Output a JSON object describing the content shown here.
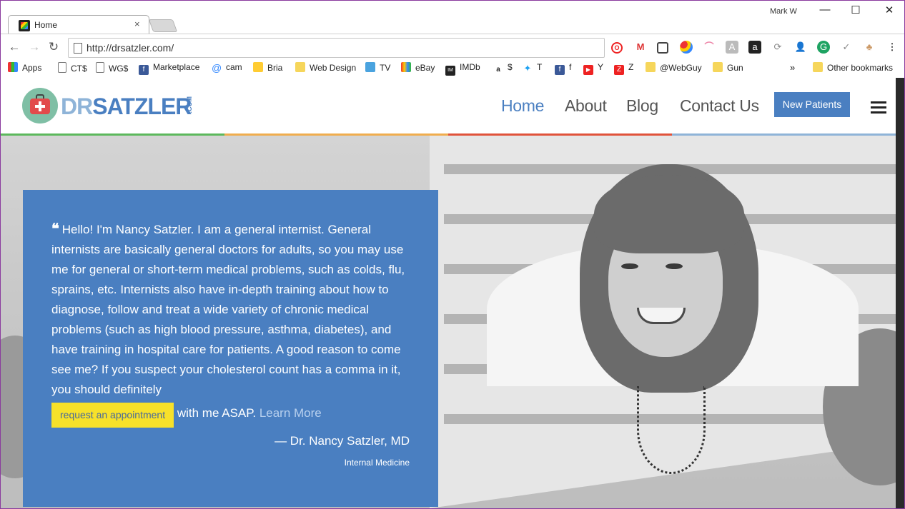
{
  "browser": {
    "tab_title": "Home",
    "tab_close": "×",
    "user_name": "Mark W",
    "url": "http://drsatzler.com/",
    "window_controls": {
      "minimize": "—",
      "maximize": "☐",
      "close": "✕"
    },
    "nav": {
      "back": "←",
      "forward": "→",
      "reload": "↻"
    },
    "menu_icon": "⋮",
    "bookmarks": [
      {
        "label": "Apps",
        "icon": "apps-grid-icon"
      },
      {
        "label": "CT$",
        "icon": "page-icon"
      },
      {
        "label": "WG$",
        "icon": "page-icon"
      },
      {
        "label": "Marketplace",
        "icon": "facebook-icon"
      },
      {
        "label": "cam",
        "icon": "at-icon"
      },
      {
        "label": "Bria",
        "icon": "bria-icon"
      },
      {
        "label": "Web Design",
        "icon": "folder-icon"
      },
      {
        "label": "TV",
        "icon": "tv-icon"
      },
      {
        "label": "eBay",
        "icon": "ebay-icon"
      },
      {
        "label": "IMDb",
        "icon": "imdb-icon"
      },
      {
        "label": "$",
        "icon": "amazon-icon"
      },
      {
        "label": "T",
        "icon": "twitter-icon"
      },
      {
        "label": "f",
        "icon": "facebook-icon"
      },
      {
        "label": "Y",
        "icon": "youtube-icon"
      },
      {
        "label": "Z",
        "icon": "z-icon"
      },
      {
        "label": "@WebGuy",
        "icon": "folder-icon"
      },
      {
        "label": "Gun",
        "icon": "folder-icon"
      }
    ],
    "bookmarks_overflow": "»",
    "other_bookmarks": "Other bookmarks"
  },
  "site": {
    "logo": {
      "dr": "DR",
      "name": "SATZLER",
      "com": ".COM"
    },
    "nav": [
      {
        "label": "Home",
        "active": true
      },
      {
        "label": "About",
        "active": false
      },
      {
        "label": "Blog",
        "active": false
      },
      {
        "label": "Contact Us",
        "active": false
      }
    ],
    "cta_button": "New Patients",
    "accent_colors": {
      "blue": "#4a7fc1",
      "yellow": "#f7e12a",
      "green": "#5cb85c",
      "orange": "#f0ad4e",
      "red": "#e0533b"
    },
    "hero": {
      "quote_mark": "❝",
      "quote_text": "Hello! I'm Nancy Satzler. I am a general internist. General internists are basically general doctors for adults, so you may use me for general or short-term medical problems, such as colds, flu, sprains, etc. Internists also have in-depth training about how to diagnose, follow and treat a wide variety of chronic medical problems (such as high blood pressure, asthma, diabetes), and have training in hospital care for patients. A good reason to come see me? If you suspect your cholesterol count has a comma in it, you should definitely",
      "appointment_button": "request an appointment",
      "after_button": " with me ASAP. ",
      "learn_more": "Learn More",
      "signature": "— Dr. Nancy Satzler, MD",
      "specialty": "Internal Medicine"
    }
  }
}
